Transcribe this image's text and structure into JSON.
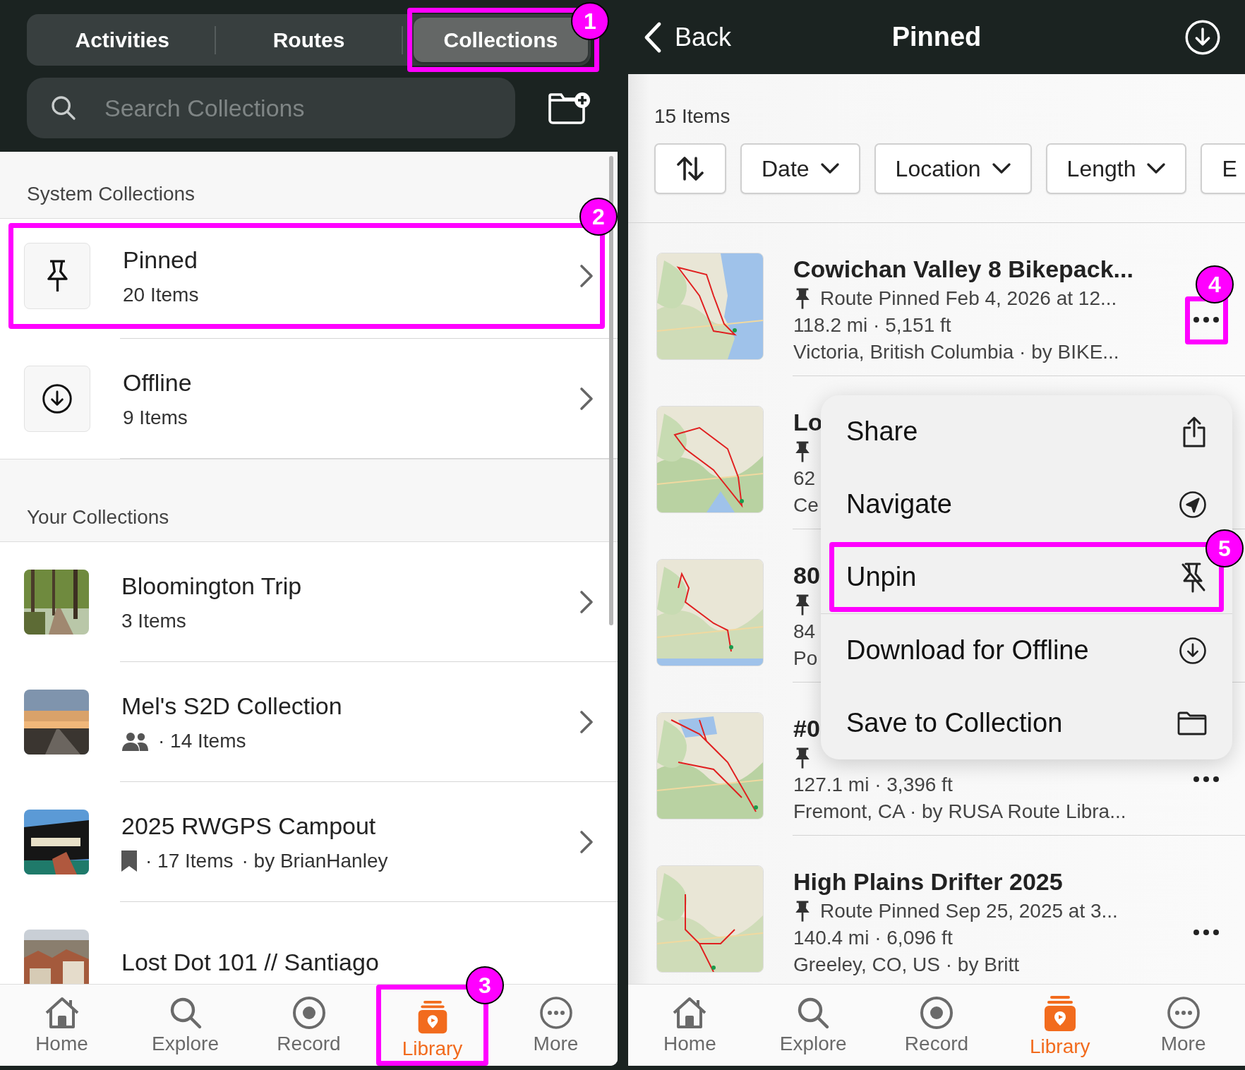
{
  "collections_pane": {
    "segments": [
      {
        "label": "Activities",
        "selected": false
      },
      {
        "label": "Routes",
        "selected": false
      },
      {
        "label": "Collections",
        "selected": true,
        "callout": "1"
      }
    ],
    "search": {
      "placeholder": "Search Collections"
    },
    "sections": [
      {
        "title": "System Collections",
        "items": [
          {
            "title": "Pinned",
            "subtitle": "20 Items",
            "callout": "2"
          },
          {
            "title": "Offline",
            "subtitle": "9 Items"
          }
        ]
      },
      {
        "title": "Your Collections",
        "items": [
          {
            "title": "Bloomington Trip",
            "count": "3 Items",
            "shared": false,
            "saved": false
          },
          {
            "title": "Mel's S2D Collection",
            "count": "· 14 Items",
            "shared": true,
            "saved": false
          },
          {
            "title": "2025 RWGPS Campout",
            "count": "· 17 Items",
            "owner": "· by BrianHanley",
            "shared": false,
            "saved": true
          },
          {
            "title": "Lost Dot 101 // Santiago",
            "shared": false,
            "saved": false
          }
        ]
      }
    ],
    "tab_bar": [
      {
        "label": "Home",
        "selected": false
      },
      {
        "label": "Explore",
        "selected": false
      },
      {
        "label": "Record",
        "selected": false
      },
      {
        "label": "Library",
        "selected": true,
        "callout": "3"
      },
      {
        "label": "More",
        "selected": false
      }
    ]
  },
  "pinned_pane": {
    "back": "Back",
    "title": "Pinned",
    "count": "15 Items",
    "filters": [
      {
        "kind": "sort"
      },
      {
        "kind": "dropdown",
        "label": "Date"
      },
      {
        "kind": "dropdown",
        "label": "Location"
      },
      {
        "kind": "dropdown",
        "label": "Length"
      },
      {
        "kind": "cut",
        "label": "E"
      }
    ],
    "routes": [
      {
        "title": "Cowichan Valley 8 Bikepack...",
        "pinned": "Route Pinned Feb 4, 2026 at 12...",
        "stats": "118.2 mi · 5,151 ft",
        "location": "Victoria, British Columbia · by BIKE...",
        "more": true,
        "callout": "4"
      },
      {
        "title": "Lo",
        "stats": "62",
        "location": "Ce",
        "more": false
      },
      {
        "title": "80",
        "stats": "84",
        "location": "Po",
        "more": false
      },
      {
        "title": "#0",
        "stats": "127.1 mi · 3,396 ft",
        "location": "Fremont, CA · by RUSA Route Libra...",
        "more": true
      },
      {
        "title": "High Plains Drifter 2025",
        "pinned": "Route Pinned Sep 25, 2025 at 3...",
        "stats": "140.4 mi · 6,096 ft",
        "location": "Greeley, CO, US · by Britt",
        "more": true
      }
    ],
    "menu": [
      {
        "label": "Share"
      },
      {
        "label": "Navigate"
      },
      {
        "label": "Unpin",
        "callout": "5"
      },
      {
        "label": "Download for Offline"
      },
      {
        "label": "Save to Collection"
      }
    ],
    "tab_bar": [
      {
        "label": "Home",
        "selected": false
      },
      {
        "label": "Explore",
        "selected": false
      },
      {
        "label": "Record",
        "selected": false
      },
      {
        "label": "Library",
        "selected": true
      },
      {
        "label": "More",
        "selected": false
      }
    ]
  }
}
